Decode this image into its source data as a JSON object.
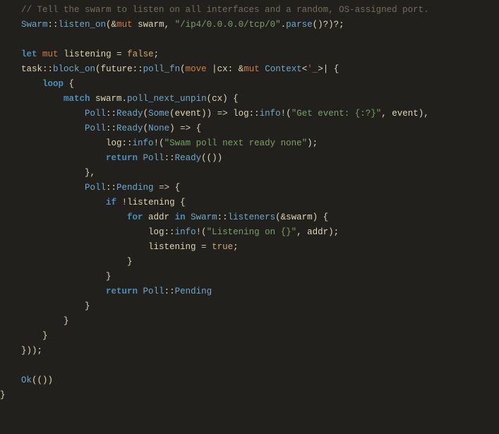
{
  "code": {
    "comment": "    // Tell the swarm to listen on all interfaces and a random, OS-assigned port.",
    "l2a": "    Swarm",
    "l2b": "listen_on",
    "l2c": "mut",
    "l2d": " swarm, ",
    "l2e": "\"/ip4/0.0.0.0/tcp/0\"",
    "l2f": "parse",
    "l3a": "    ",
    "l3b": "let",
    "l3c": "mut",
    "l3d": " listening ",
    "l3e": "false",
    "l4a": "    task",
    "l4b": "block_on",
    "l4c": "future",
    "l4d": "poll_fn",
    "l4e": "move",
    "l4f": "cx: ",
    "l4g": "mut",
    "l4h": " Context",
    "l4i": "'_",
    "l5a": "        ",
    "l5b": "loop",
    "l6a": "            ",
    "l6b": "match",
    "l6c": " swarm.",
    "l6d": "poll_next_unpin",
    "l6e": "(cx) {",
    "l7a": "                Poll",
    "l7b": "Ready",
    "l7c": "Some",
    "l7d": "(event)) ",
    "l7e": " log",
    "l7f": "info",
    "l7g": "\"Get event: {:?}\"",
    "l7h": ", event),",
    "l8a": "                Poll",
    "l8b": "Ready",
    "l8c": "None",
    "l9a": "                    log",
    "l9b": "info",
    "l9c": "\"Swam poll next ready none\"",
    "l10a": "                    ",
    "l10b": "return",
    "l10c": " Poll",
    "l10d": "Ready",
    "l11a": "                },",
    "l12a": "                Poll",
    "l12b": "Pending",
    "l13a": "                    ",
    "l13b": "if",
    "l13c": "listening {",
    "l14a": "                        ",
    "l14b": "for",
    "l14c": " addr ",
    "l14d": "in",
    "l14e": " Swarm",
    "l14f": "listeners",
    "l14g": "swarm) {",
    "l15a": "                            log",
    "l15b": "info",
    "l15c": "\"Listening on {}\"",
    "l15d": ", addr);",
    "l16a": "                            listening ",
    "l16b": "true",
    "l17a": "                        }",
    "l18a": "                    }",
    "l19a": "                    ",
    "l19b": "return",
    "l19c": " Poll",
    "l19d": "Pending",
    "l20a": "                }",
    "l21a": "            }",
    "l22a": "        }",
    "l23a": "    }));",
    "l24a": "    ",
    "l24b": "Ok",
    "l25a": "}"
  }
}
